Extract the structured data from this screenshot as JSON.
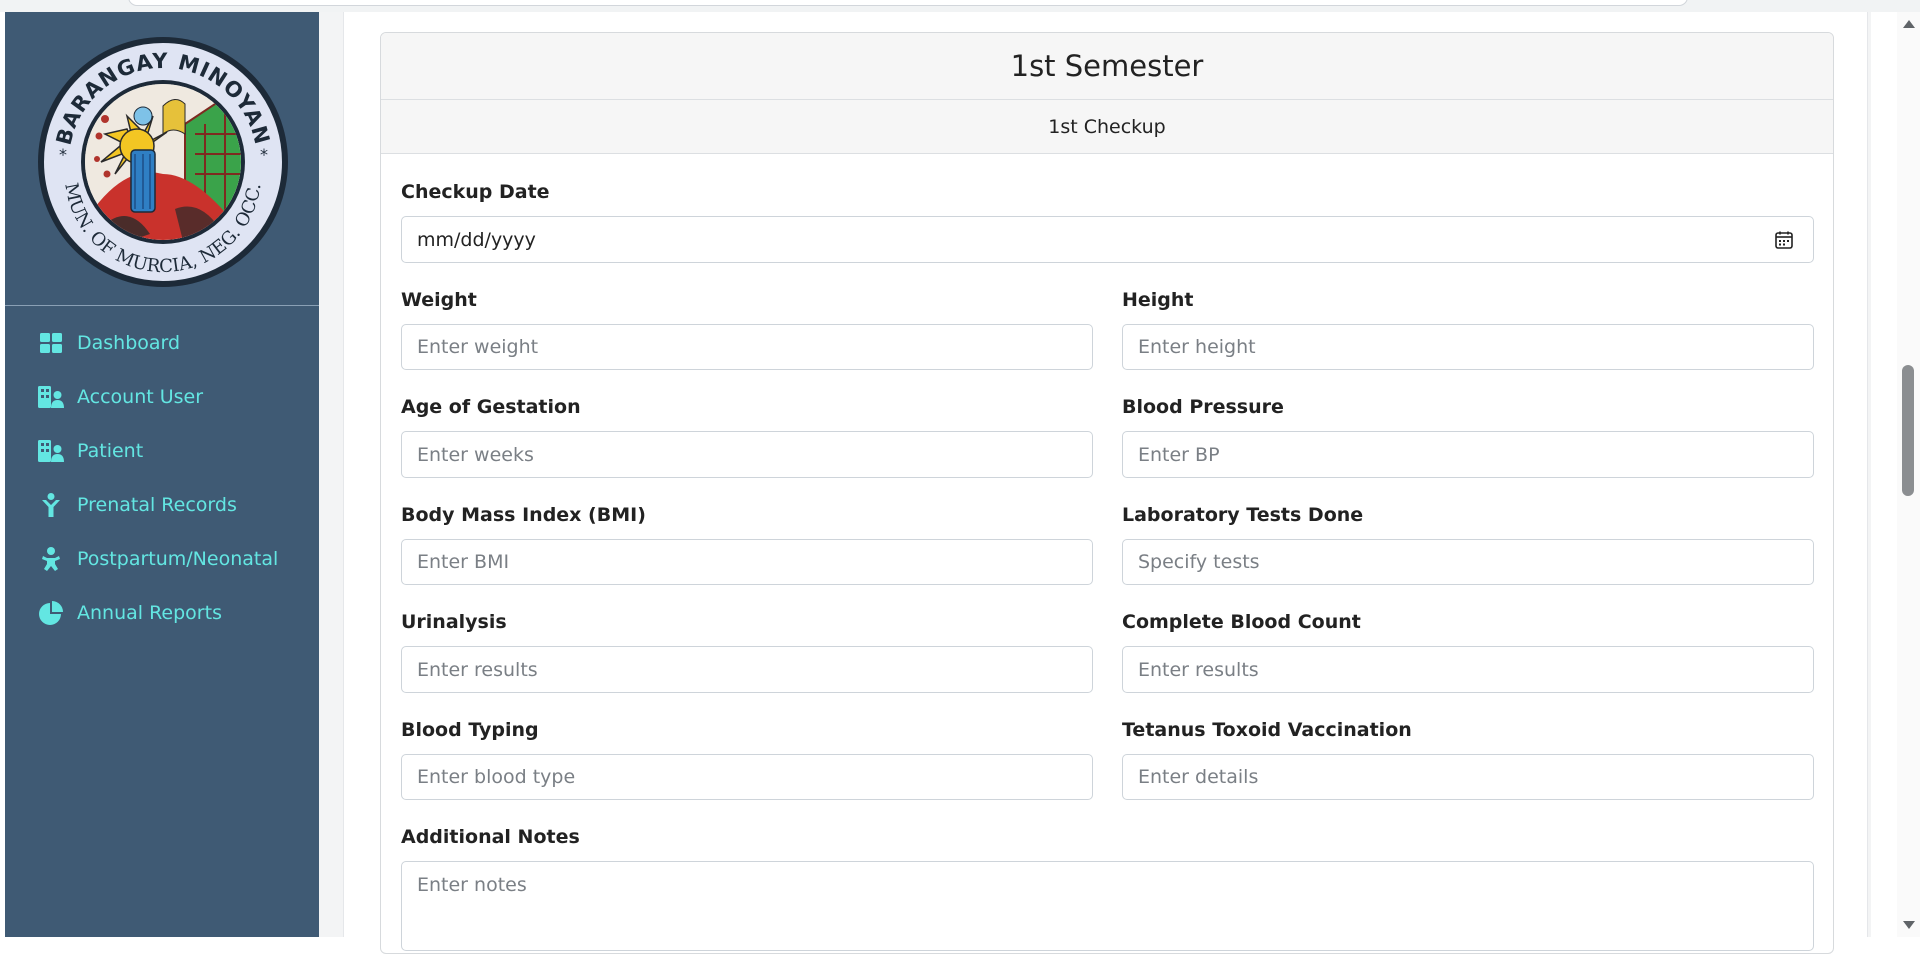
{
  "sidebar": {
    "logo": {
      "top_text": "BARANGAY MINOYAN",
      "bottom_text": "MUN. OF MURCIA, NEG. OCC."
    },
    "items": [
      {
        "label": "Dashboard",
        "icon": "dashboard-icon"
      },
      {
        "label": "Account User",
        "icon": "users-building-icon"
      },
      {
        "label": "Patient",
        "icon": "users-building-icon"
      },
      {
        "label": "Prenatal Records",
        "icon": "person-icon"
      },
      {
        "label": "Postpartum/Neonatal",
        "icon": "baby-icon"
      },
      {
        "label": "Annual Reports",
        "icon": "pie-chart-icon"
      }
    ],
    "colors": {
      "background": "#3f5a74",
      "accent": "#63e6e2"
    }
  },
  "form": {
    "title": "1st Semester",
    "subtitle": "1st Checkup",
    "checkup_date": {
      "label": "Checkup Date",
      "value": "mm/dd/yyyy"
    },
    "weight": {
      "label": "Weight",
      "placeholder": "Enter weight"
    },
    "height": {
      "label": "Height",
      "placeholder": "Enter height"
    },
    "age_of_gestation": {
      "label": "Age of Gestation",
      "placeholder": "Enter weeks"
    },
    "blood_pressure": {
      "label": "Blood Pressure",
      "placeholder": "Enter BP"
    },
    "bmi": {
      "label": "Body Mass Index (BMI)",
      "placeholder": "Enter BMI"
    },
    "lab_tests": {
      "label": "Laboratory Tests Done",
      "placeholder": "Specify tests"
    },
    "urinalysis": {
      "label": "Urinalysis",
      "placeholder": "Enter results"
    },
    "cbc": {
      "label": "Complete Blood Count",
      "placeholder": "Enter results"
    },
    "blood_typing": {
      "label": "Blood Typing",
      "placeholder": "Enter blood type"
    },
    "tetanus": {
      "label": "Tetanus Toxoid Vaccination",
      "placeholder": "Enter details"
    },
    "notes": {
      "label": "Additional Notes",
      "placeholder": "Enter notes"
    }
  }
}
